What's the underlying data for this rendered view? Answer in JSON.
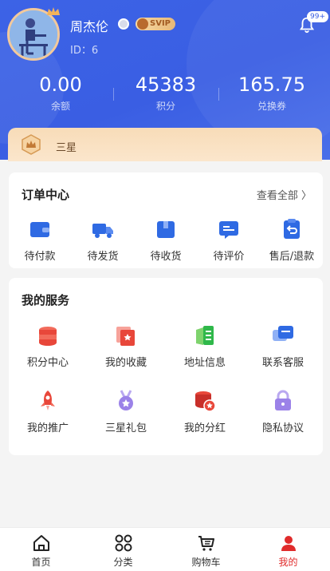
{
  "user": {
    "name": "周杰伦",
    "id_label": "ID：6",
    "vip_label": "SVIP",
    "notification_count": "99+"
  },
  "stats": [
    {
      "value": "0.00",
      "label": "余额"
    },
    {
      "value": "45383",
      "label": "积分"
    },
    {
      "value": "165.75",
      "label": "兑换券"
    }
  ],
  "level": {
    "name": "三星"
  },
  "orders": {
    "title": "订单中心",
    "view_all": "查看全部 〉",
    "items": [
      {
        "label": "待付款",
        "icon": "wallet-icon"
      },
      {
        "label": "待发货",
        "icon": "truck-icon"
      },
      {
        "label": "待收货",
        "icon": "package-icon"
      },
      {
        "label": "待评价",
        "icon": "review-icon"
      },
      {
        "label": "售后/退款",
        "icon": "refund-icon"
      }
    ]
  },
  "services": {
    "title": "我的服务",
    "items": [
      {
        "label": "积分中心",
        "icon": "coins-icon"
      },
      {
        "label": "我的收藏",
        "icon": "favorites-icon"
      },
      {
        "label": "地址信息",
        "icon": "address-icon"
      },
      {
        "label": "联系客服",
        "icon": "chat-icon"
      },
      {
        "label": "我的推广",
        "icon": "rocket-icon"
      },
      {
        "label": "三星礼包",
        "icon": "medal-icon"
      },
      {
        "label": "我的分红",
        "icon": "dividend-icon"
      },
      {
        "label": "隐私协议",
        "icon": "lock-icon"
      }
    ]
  },
  "tabbar": [
    {
      "label": "首页",
      "icon": "home-icon"
    },
    {
      "label": "分类",
      "icon": "category-icon"
    },
    {
      "label": "购物车",
      "icon": "cart-icon"
    },
    {
      "label": "我的",
      "icon": "profile-icon",
      "active": true
    }
  ],
  "colors": {
    "primary": "#3a5ee3",
    "accent_red": "#e02b2b",
    "gold": "#f6d9a6"
  }
}
